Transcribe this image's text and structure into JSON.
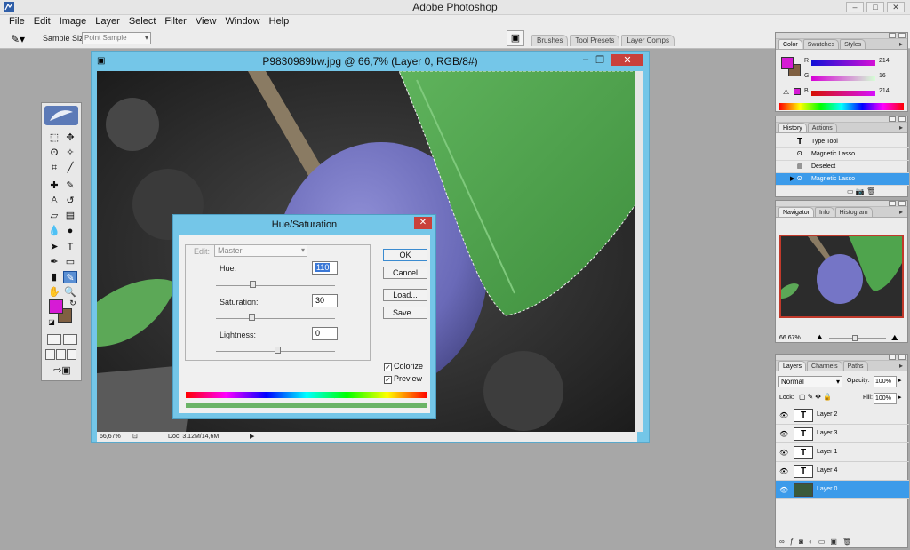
{
  "app": {
    "title": "Adobe Photoshop"
  },
  "menu": [
    "File",
    "Edit",
    "Image",
    "Layer",
    "Select",
    "Filter",
    "View",
    "Window",
    "Help"
  ],
  "options": {
    "sample_size_label": "Sample Size:",
    "sample_size_value": "Point Sample"
  },
  "palette_well": [
    "Brushes",
    "Tool Presets",
    "Layer Comps"
  ],
  "document": {
    "title": "P9830989bw.jpg @ 66,7% (Layer 0, RGB/8#)",
    "zoom": "66,67%",
    "doc_size": "Doc: 3.12M/14,6M"
  },
  "hue_saturation": {
    "title": "Hue/Saturation",
    "edit_label": "Edit:",
    "edit_value": "Master",
    "hue_label": "Hue:",
    "hue_value": "110",
    "saturation_label": "Saturation:",
    "saturation_value": "30",
    "lightness_label": "Lightness:",
    "lightness_value": "0",
    "ok": "OK",
    "cancel": "Cancel",
    "load": "Load...",
    "save": "Save...",
    "colorize": "Colorize",
    "preview": "Preview",
    "colorize_checked": true,
    "preview_checked": true
  },
  "color_panel": {
    "tabs": [
      "Color",
      "Swatches",
      "Styles"
    ],
    "channels": [
      {
        "label": "R",
        "value": "214"
      },
      {
        "label": "G",
        "value": "16"
      },
      {
        "label": "B",
        "value": "214"
      }
    ],
    "foreground": "#d61bd5",
    "background": "#806042"
  },
  "history_panel": {
    "tabs": [
      "History",
      "Actions"
    ],
    "items": [
      "Type Tool",
      "Magnetic Lasso",
      "Deselect",
      "Magnetic Lasso"
    ]
  },
  "navigator_panel": {
    "tabs": [
      "Navigator",
      "Info",
      "Histogram"
    ],
    "zoom": "66.67%"
  },
  "layers_panel": {
    "tabs": [
      "Layers",
      "Channels",
      "Paths"
    ],
    "blend_mode": "Normal",
    "opacity_label": "Opacity:",
    "opacity": "100%",
    "lock_label": "Lock:",
    "fill_label": "Fill:",
    "fill": "100%",
    "layers": [
      "Layer 2",
      "Layer 3",
      "Layer 1",
      "Layer 4",
      "Layer 0"
    ]
  }
}
